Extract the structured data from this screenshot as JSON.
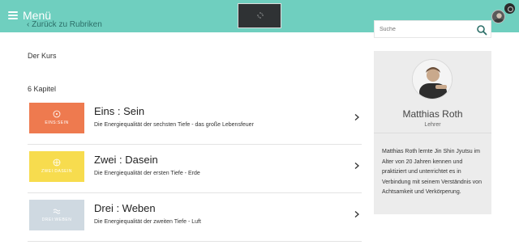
{
  "header": {
    "menu_label": "Menü",
    "back_label": "‹ Zurück zu Rubriken",
    "search_placeholder": "Suche",
    "logo": {
      "top_text": "",
      "bottom_text": ""
    }
  },
  "main": {
    "course_label": "Der Kurs",
    "chapters_label": "6 Kapitel",
    "chapters": [
      {
        "title": "Eins : Sein",
        "description": "Die Energiequalität der sechsten Tiefe - das große Lebensfeuer",
        "thumb_text": "EINS:SEIN",
        "thumb_color": "#ee7a4f",
        "thumb_icon": "circle-dot-icon"
      },
      {
        "title": "Zwei : Dasein",
        "description": "Die Energiequalität der ersten Tiefe - Erde",
        "thumb_text": "ZWEI:DASEIN",
        "thumb_color": "#f7dc4e",
        "thumb_icon": "circle-cross-icon"
      },
      {
        "title": "Drei : Weben",
        "description": "Die Energiequalität der zweiten Tiefe - Luft",
        "thumb_text": "DREI:WEBEN",
        "thumb_color": "#cfd9e1",
        "thumb_icon": "wave-icon"
      }
    ]
  },
  "sidebar": {
    "name": "Matthias Roth",
    "role": "Lehrer",
    "bio": "Matthias Roth lernte Jin Shin Jyutsu im Alter von 20 Jahren kennen und praktiziert und unterrichtet es in Verbindung mit seinem Verständnis von Achtsamkeit und Verkörperung."
  },
  "colors": {
    "topbar": "#6fcfbf",
    "panel": "#ececec"
  }
}
